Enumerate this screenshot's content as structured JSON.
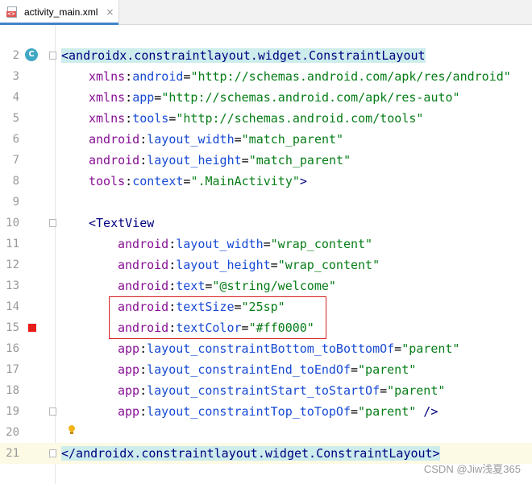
{
  "tab": {
    "title": "activity_main.xml",
    "close": "×",
    "icon": "xml-file-icon"
  },
  "lines": [
    {
      "n": "2",
      "t": "<androidx.constraintlayout.widget.ConstraintLayout"
    },
    {
      "n": "3",
      "t": "xmlns:android=\"http://schemas.android.com/apk/res/android\""
    },
    {
      "n": "4",
      "t": "xmlns:app=\"http://schemas.android.com/apk/res-auto\""
    },
    {
      "n": "5",
      "t": "xmlns:tools=\"http://schemas.android.com/tools\""
    },
    {
      "n": "6",
      "t": "android:layout_width=\"match_parent\""
    },
    {
      "n": "7",
      "t": "android:layout_height=\"match_parent\""
    },
    {
      "n": "8",
      "t": "tools:context=\".MainActivity\">"
    },
    {
      "n": "9",
      "t": ""
    },
    {
      "n": "10",
      "t": "<TextView"
    },
    {
      "n": "11",
      "t": "android:layout_width=\"wrap_content\""
    },
    {
      "n": "12",
      "t": "android:layout_height=\"wrap_content\""
    },
    {
      "n": "13",
      "t": "android:text=\"@string/welcome\""
    },
    {
      "n": "14",
      "t": "android:textSize=\"25sp\""
    },
    {
      "n": "15",
      "t": "android:textColor=\"#ff0000\""
    },
    {
      "n": "16",
      "t": "app:layout_constraintBottom_toBottomOf=\"parent\""
    },
    {
      "n": "17",
      "t": "app:layout_constraintEnd_toEndOf=\"parent\""
    },
    {
      "n": "18",
      "t": "app:layout_constraintStart_toStartOf=\"parent\""
    },
    {
      "n": "19",
      "t": "app:layout_constraintTop_toTopOf=\"parent\" />"
    },
    {
      "n": "20",
      "t": ""
    },
    {
      "n": "21",
      "t": "</androidx.constraintlayout.widget.ConstraintLayout>"
    }
  ],
  "gutter_icons": {
    "class_marker": "C",
    "class_marker_icon": "class-c-icon",
    "color_icon": "color-swatch-icon",
    "bulb_icon": "lightbulb-icon",
    "swatch_color": "#ff0000"
  },
  "watermark": "CSDN @Jiw浅夏365"
}
